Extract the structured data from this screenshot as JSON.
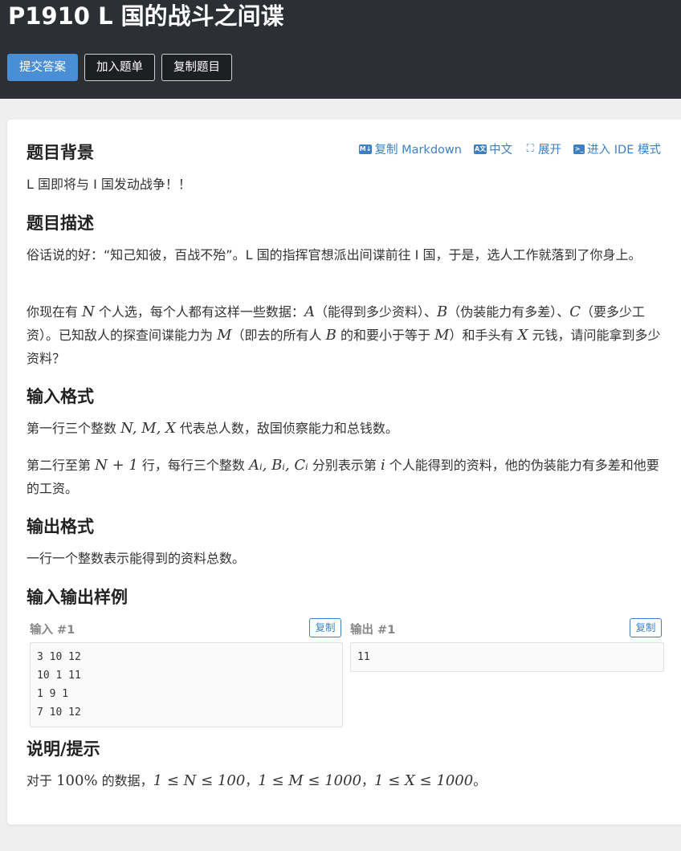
{
  "header": {
    "title": "P1910 L 国的战斗之间谍",
    "buttons": {
      "submit": "提交答案",
      "add_to_list": "加入题单",
      "copy_problem": "复制题目"
    }
  },
  "toolbar": {
    "copy_markdown": "复制 Markdown",
    "chinese": "中文",
    "expand": "展开",
    "ide_mode": "进入 IDE 模式",
    "icons": {
      "markdown": "markdown-icon",
      "translate": "translate-icon",
      "expand": "expand-icon",
      "terminal": "terminal-icon"
    }
  },
  "sections": {
    "background": {
      "heading": "题目背景",
      "text": "L 国即将与 I 国发动战争！！"
    },
    "description": {
      "heading": "题目描述",
      "p1": "俗话说的好：“知己知彼，百战不殆”。L 国的指挥官想派出间谍前往 I 国，于是，选人工作就落到了你身上。",
      "p2_parts": {
        "a": "你现在有 ",
        "N": "N",
        "b": " 个人选，每个人都有这样一些数据：",
        "A": "A",
        "c": "（能得到多少资料）、",
        "B": "B",
        "d": "（伪装能力有多差）、",
        "C": "C",
        "e": "（要多少工资）。已知敌人的探查间谍能力为 ",
        "M": "M",
        "f": "（即去的所有人 ",
        "B2": "B",
        "g": " 的和要小于等于 ",
        "M2": "M",
        "h": "）和手头有 ",
        "X": "X",
        "i": " 元钱，请问能拿到多少资料？"
      }
    },
    "input_format": {
      "heading": "输入格式",
      "l1_parts": {
        "a": "第一行三个整数 ",
        "vars": "N, M, X",
        "b": " 代表总人数，敌国侦察能力和总钱数。"
      },
      "l2_parts": {
        "a": "第二行至第 ",
        "expr": "N + 1",
        "b": " 行，每行三个整数 ",
        "vars": "Aᵢ, Bᵢ, Cᵢ",
        "c": " 分别表示第 ",
        "i": "i",
        "d": " 个人能得到的资料，他的伪装能力有多差和他要的工资。"
      }
    },
    "output_format": {
      "heading": "输出格式",
      "text": "一行一个整数表示能得到的资料总数。"
    },
    "samples": {
      "heading": "输入输出样例",
      "input_label": "输入 #1",
      "output_label": "输出 #1",
      "copy_label": "复制",
      "input_lines": [
        "3 10 12",
        "10 1 11",
        "1 9 1",
        "7 10 12"
      ],
      "output_lines": [
        "11"
      ]
    },
    "hint": {
      "heading": "说明/提示",
      "parts": {
        "a": "对于 ",
        "pct": "100%",
        "b": " 的数据，",
        "c1": "1 ≤ N ≤ 100",
        "s1": "，",
        "c2": "1 ≤ M ≤ 1000",
        "s2": "，",
        "c3": "1 ≤ X ≤ 1000",
        "end": "。"
      }
    }
  }
}
